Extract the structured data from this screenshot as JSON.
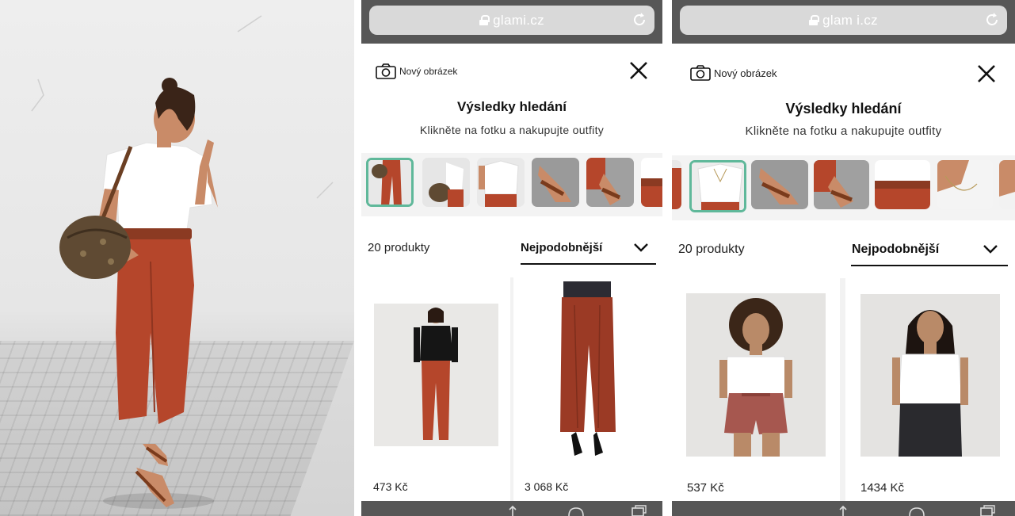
{
  "colors": {
    "accent_green": "#5fb89a",
    "chrome_gray": "#575757",
    "url_field": "#d9d9d9",
    "rust_red": "#b5462b",
    "card_bg": "#f2f2f2"
  },
  "photo": {
    "alt_icon": "outfit-photo"
  },
  "screens": [
    {
      "browser": {
        "url": "glami.cz",
        "lock_icon": "lock-icon",
        "reload_icon": "reload-icon"
      },
      "header": {
        "new_image_label": "Nový obrázek",
        "camera_icon": "camera-icon",
        "close_icon": "close-icon"
      },
      "title": "Výsledky hledání",
      "subtitle": "Klikněte na fotku a nakupujte outfity",
      "thumbnails": [
        "pants",
        "bag",
        "top",
        "sandal",
        "sandal-2",
        "belt"
      ],
      "selected_thumbnail": 0,
      "results": {
        "count_label": "20 produkty",
        "sort_label": "Nejpodobnější",
        "sort_icon": "chevron-down-icon"
      },
      "products": [
        {
          "price": "473 Kč",
          "image": "model-black-top-red-pants"
        },
        {
          "price": "3 068 Kč",
          "image": "red-corduroy-pants"
        }
      ]
    },
    {
      "browser": {
        "url": "glam i.cz",
        "lock_icon": "lock-icon",
        "reload_icon": "reload-icon"
      },
      "header": {
        "new_image_label": "Nový obrázek",
        "camera_icon": "camera-icon",
        "close_icon": "close-icon"
      },
      "title": "Výsledky hledání",
      "subtitle": "Klikněte na fotku a nakupujte outfity",
      "thumbnails": [
        "top",
        "sandal",
        "sandal-2",
        "belt",
        "necklace",
        "necklace-2"
      ],
      "selected_thumbnail": 0,
      "results": {
        "count_label": "20 produkty",
        "sort_label": "Nejpodobnější",
        "sort_icon": "chevron-down-icon"
      },
      "products": [
        {
          "price": "537 Kč",
          "image": "model-white-tee-pink-shorts"
        },
        {
          "price": "1434 Kč",
          "image": "model-white-tee-black-jeans"
        }
      ]
    }
  ]
}
